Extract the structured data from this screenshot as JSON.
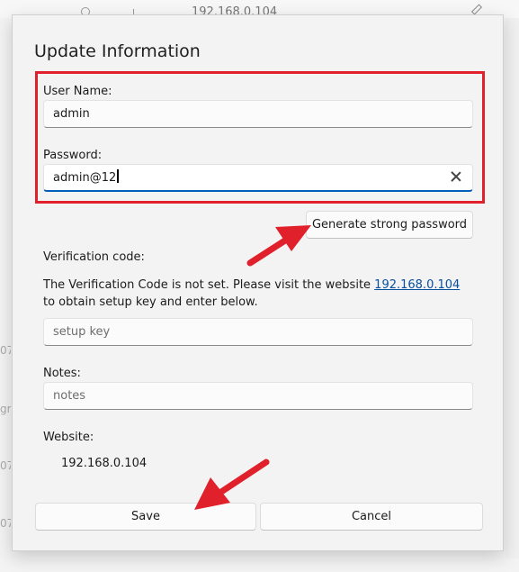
{
  "background": {
    "url_text": "192.168.0.104",
    "side_fragments": [
      "07",
      "gr",
      "07",
      "07"
    ]
  },
  "dialog": {
    "title": "Update Information",
    "username": {
      "label": "User Name:",
      "value": "admin"
    },
    "password": {
      "label": "Password:",
      "value": "admin@12"
    },
    "generate_button": "Generate strong password",
    "verification": {
      "label": "Verification code:",
      "text_before": "The Verification Code is not set. Please visit the website ",
      "link": "192.168.0.104",
      "text_after": " to obtain setup key and enter below.",
      "placeholder": "setup key"
    },
    "notes": {
      "label": "Notes:",
      "placeholder": "notes"
    },
    "website": {
      "label": "Website:",
      "value": "192.168.0.104"
    },
    "save_button": "Save",
    "cancel_button": "Cancel"
  },
  "colors": {
    "highlight_box": "#e0202a",
    "arrow": "#e0202a",
    "focus_underline": "#005fb8",
    "link": "#0a4f9e"
  }
}
